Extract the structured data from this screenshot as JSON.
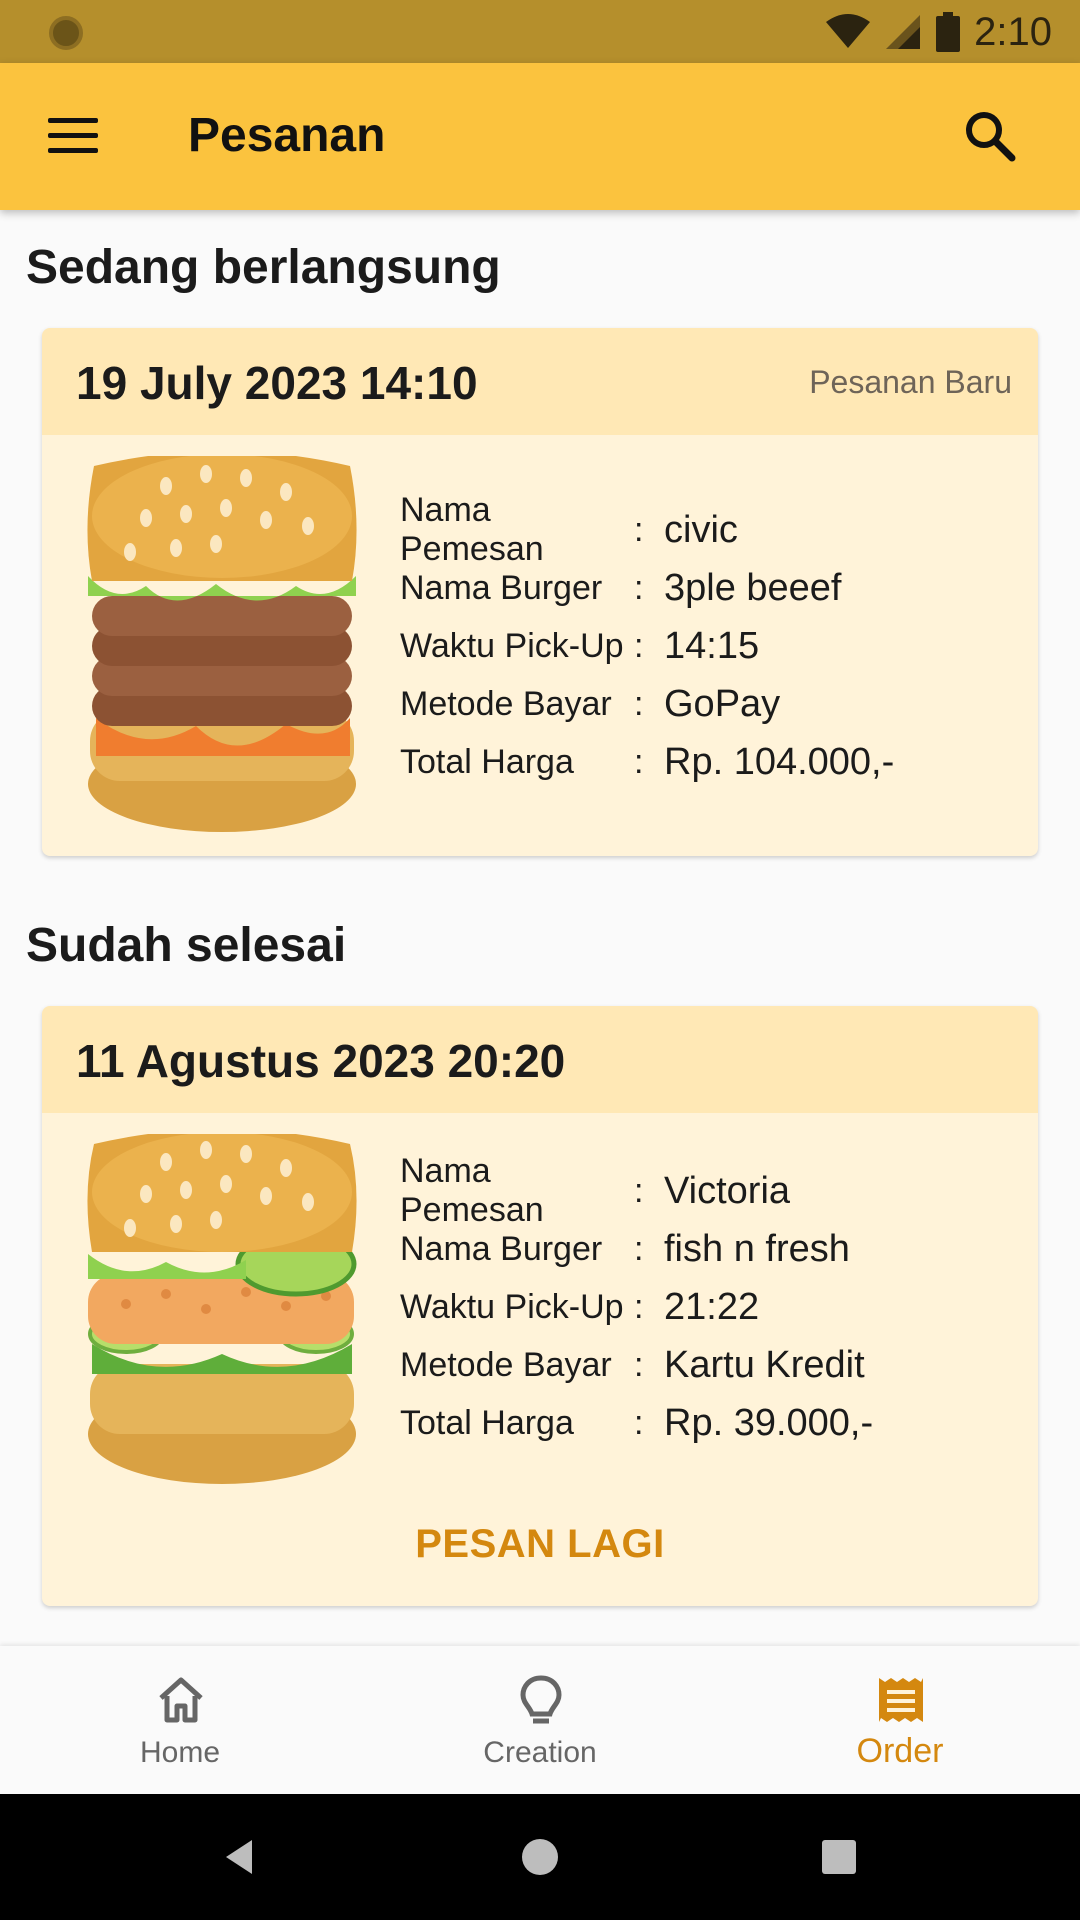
{
  "status_bar": {
    "time": "2:10"
  },
  "app_bar": {
    "title": "Pesanan"
  },
  "sections": {
    "ongoing_title": "Sedang berlangsung",
    "done_title": "Sudah selesai"
  },
  "labels": {
    "name": "Nama Pemesan",
    "burger": "Nama Burger",
    "pickup": "Waktu Pick-Up",
    "payment": "Metode Bayar",
    "total": "Total Harga",
    "separator": ":"
  },
  "orders": [
    {
      "datetime": "19 July 2023  14:10",
      "status": "Pesanan Baru",
      "name": "civic",
      "burger": "3ple beeef",
      "pickup": "14:15",
      "payment": "GoPay",
      "total": "Rp. 104.000,-"
    },
    {
      "datetime": "11 Agustus 2023  20:20",
      "name": "Victoria",
      "burger": "fish n fresh",
      "pickup": "21:22",
      "payment": "Kartu Kredit",
      "total": "Rp. 39.000,-",
      "action": "PESAN LAGI"
    }
  ],
  "bottom_nav": {
    "items": [
      {
        "label": "Home",
        "icon": "home-icon"
      },
      {
        "label": "Creation",
        "icon": "lightbulb-icon"
      },
      {
        "label": "Order",
        "icon": "receipt-icon",
        "active": true
      }
    ]
  },
  "colors": {
    "status_bar": "#b58f2c",
    "app_bar": "#fbc33e",
    "accent": "#d4880f",
    "card_header": "#ffe8b5",
    "card_body": "#fff3d9"
  }
}
